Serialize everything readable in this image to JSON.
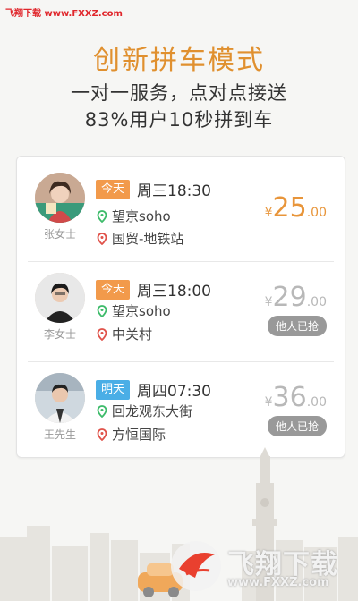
{
  "watermark": {
    "site": "飞翔下载 www.FXXZ.com"
  },
  "hero": {
    "title": "创新拼车模式",
    "line1": "一对一服务，点对点接送",
    "line2": "83%用户10秒拼到车"
  },
  "rides": [
    {
      "name": "张女士",
      "day": "今天",
      "day_color": "orange",
      "time": "周三18:30",
      "from": "望京soho",
      "to": "国贸-地铁站",
      "currency": "¥",
      "price_int": "25",
      "price_dec": ".00",
      "status": "available"
    },
    {
      "name": "李女士",
      "day": "今天",
      "day_color": "orange",
      "time": "周三18:00",
      "from": "望京soho",
      "to": "中关村",
      "currency": "¥",
      "price_int": "29",
      "price_dec": ".00",
      "status": "taken",
      "status_label": "他人已抢"
    },
    {
      "name": "王先生",
      "day": "明天",
      "day_color": "blue",
      "time": "周四07:30",
      "from": "回龙观东大街",
      "to": "方恒国际",
      "currency": "¥",
      "price_int": "36",
      "price_dec": ".00",
      "status": "taken",
      "status_label": "他人已抢"
    }
  ],
  "footer_logo": {
    "brand": "飞翔下载",
    "url": "www.FXXZ.com"
  },
  "colors": {
    "accent": "#e8953a",
    "badge_today": "#f29a4b",
    "badge_tomorrow": "#4aaee6",
    "pin_green": "#3dbb6a",
    "pin_red": "#e0524a",
    "taken_gray": "#999999"
  },
  "icons": {
    "from": "green-location-pin-icon",
    "to": "red-location-pin-icon"
  }
}
